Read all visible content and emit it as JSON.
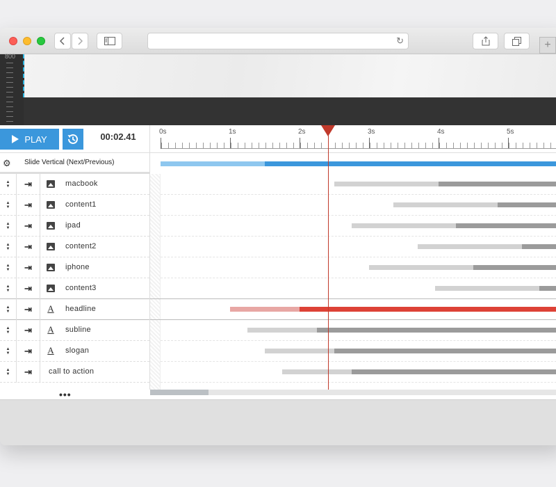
{
  "colors": {
    "accent": "#3b97dc",
    "playhead": "#c0392b",
    "group_bar_light": "#8ec7ef",
    "group_bar_dark": "#3b97dc",
    "bar_light": "#d2d2d2",
    "bar_dark": "#9b9b9b",
    "active_bar_light": "#e8a7a4",
    "active_bar_dark": "#dd4236"
  },
  "browser": {
    "url": "",
    "back_icon": "chevron-left-icon",
    "forward_icon": "chevron-right-icon",
    "sidebar_icon": "sidebar-icon",
    "reload_icon": "reload-icon",
    "share_icon": "share-icon",
    "tabs_icon": "tabs-icon",
    "new_tab_label": "+"
  },
  "stage": {
    "ruler_label": "800"
  },
  "toolbar": {
    "play_label": "PLAY",
    "replay_icon": "history-icon",
    "time": "00:02.41"
  },
  "timeline": {
    "seconds_labels": [
      "0s",
      "1s",
      "2s",
      "3s",
      "4s",
      "5s"
    ],
    "playhead_seconds": 2.41,
    "duration_visible_seconds": 5.7
  },
  "group": {
    "name": "Slide Vertical (Next/Previous)",
    "bar": {
      "start": 0,
      "split": 1.5,
      "end": 5.7
    }
  },
  "layers": [
    {
      "name": "macbook",
      "type": "image",
      "start": 2.5,
      "split": 4.0,
      "active": false
    },
    {
      "name": "content1",
      "type": "image",
      "start": 3.35,
      "split": 4.85,
      "active": false
    },
    {
      "name": "ipad",
      "type": "image",
      "start": 2.75,
      "split": 4.25,
      "active": false
    },
    {
      "name": "content2",
      "type": "image",
      "start": 3.7,
      "split": 5.2,
      "active": false
    },
    {
      "name": "iphone",
      "type": "image",
      "start": 3.0,
      "split": 4.5,
      "active": false
    },
    {
      "name": "content3",
      "type": "image",
      "start": 3.95,
      "split": 5.45,
      "active": false
    },
    {
      "name": "headline",
      "type": "text",
      "start": 1.0,
      "split": 2.0,
      "active": true
    },
    {
      "name": "subline",
      "type": "text",
      "start": 1.25,
      "split": 2.25,
      "active": false
    },
    {
      "name": "slogan",
      "type": "text",
      "start": 1.5,
      "split": 2.5,
      "active": false
    },
    {
      "name": "call to action",
      "type": "none",
      "start": 1.75,
      "split": 2.75,
      "active": false
    }
  ],
  "footer": {
    "more_label": "•••"
  }
}
